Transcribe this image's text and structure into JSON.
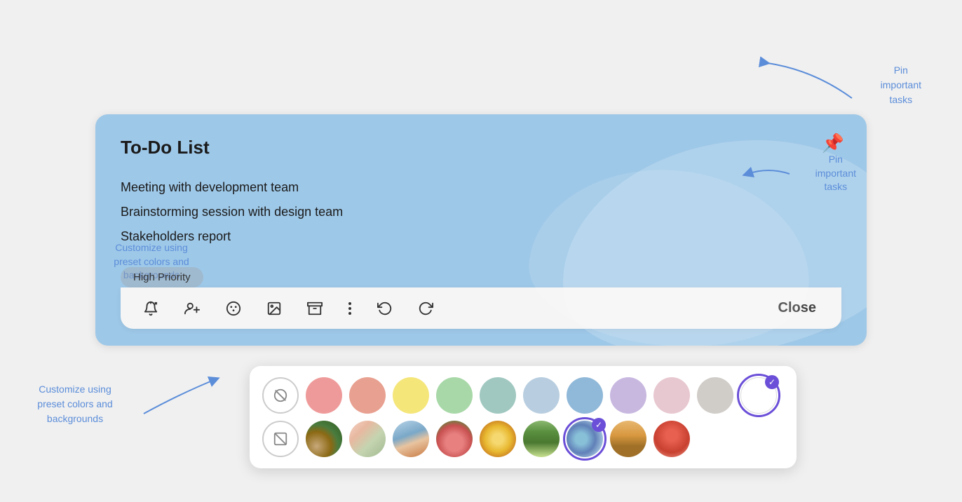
{
  "card": {
    "title": "To-Do List",
    "tasks": [
      "Meeting with development team",
      "Brainstorming session with design team",
      "Stakeholders report"
    ],
    "priority_label": "High Priority"
  },
  "toolbar": {
    "close_label": "Close",
    "icons": [
      {
        "name": "bell-add-icon",
        "symbol": "🔔",
        "title": "Add reminder"
      },
      {
        "name": "person-add-icon",
        "symbol": "👤+",
        "title": "Add collaborator"
      },
      {
        "name": "palette-icon",
        "symbol": "🎨",
        "title": "Change color"
      },
      {
        "name": "image-icon",
        "symbol": "🖼",
        "title": "Add image"
      },
      {
        "name": "archive-icon",
        "symbol": "📥",
        "title": "Archive"
      },
      {
        "name": "more-icon",
        "symbol": "⋮",
        "title": "More options"
      },
      {
        "name": "undo-icon",
        "symbol": "↺",
        "title": "Undo"
      },
      {
        "name": "redo-icon",
        "symbol": "↻",
        "title": "Redo"
      }
    ]
  },
  "color_picker": {
    "colors": [
      {
        "id": "tomato",
        "hex": "#ef9a9a",
        "selected": false
      },
      {
        "id": "flamingo",
        "hex": "#e8a090",
        "selected": false
      },
      {
        "id": "banana",
        "hex": "#f5e67a",
        "selected": false
      },
      {
        "id": "sage",
        "hex": "#a8d8a8",
        "selected": false
      },
      {
        "id": "teal",
        "hex": "#a0c8c0",
        "selected": false
      },
      {
        "id": "denim",
        "hex": "#b8cee0",
        "selected": false
      },
      {
        "id": "basil",
        "hex": "#90b8d8",
        "selected": false
      },
      {
        "id": "lavender",
        "hex": "#c8b8e0",
        "selected": false
      },
      {
        "id": "blush",
        "hex": "#e8c8d0",
        "selected": false
      },
      {
        "id": "graphite",
        "hex": "#d0ccc8",
        "selected": false
      },
      {
        "id": "white",
        "hex": "#ffffff",
        "selected": true
      }
    ],
    "backgrounds": [
      {
        "id": "bg-1",
        "selected": false
      },
      {
        "id": "bg-2",
        "selected": false
      },
      {
        "id": "bg-3",
        "selected": false
      },
      {
        "id": "bg-4",
        "selected": false
      },
      {
        "id": "bg-5",
        "selected": false
      },
      {
        "id": "bg-6",
        "selected": false
      },
      {
        "id": "bg-7",
        "selected": true
      },
      {
        "id": "bg-8",
        "selected": false
      },
      {
        "id": "bg-9",
        "selected": false
      }
    ]
  },
  "annotations": {
    "pin": {
      "text": "Pin\nimportant\ntasks",
      "arrow_direction": "left"
    },
    "customize": {
      "text": "Customize using\npreset colors and\nbackgrounds",
      "arrow_direction": "right"
    }
  }
}
